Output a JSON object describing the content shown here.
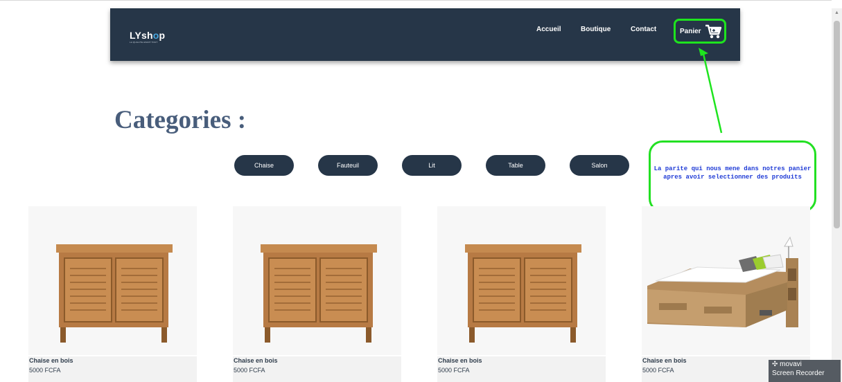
{
  "brand": {
    "name_prefix": "LYsh",
    "name_o": "o",
    "name_suffix": "p",
    "tagline": "LA QUALITE AVANT TOUT"
  },
  "nav": {
    "links": [
      "Accueil",
      "Boutique",
      "Contact"
    ],
    "cart_label": "Panier"
  },
  "page": {
    "heading": "Categories :"
  },
  "categories": [
    "Chaise",
    "Fauteuil",
    "Lit",
    "Table",
    "Salon"
  ],
  "annotation": {
    "text": "La parite qui nous mene dans notres panier apres avoir selectionner des produits"
  },
  "products": [
    {
      "name": "Chaise en bois",
      "price": "5000 FCFA",
      "image": "wooden-cabinet"
    },
    {
      "name": "Chaise en bois",
      "price": "5000 FCFA",
      "image": "wooden-cabinet"
    },
    {
      "name": "Chaise en bois",
      "price": "5000 FCFA",
      "image": "wooden-cabinet"
    },
    {
      "name": "Chaise en bois",
      "price": "5000 FCFA",
      "image": "wooden-bed"
    }
  ],
  "watermark": {
    "brand": "movavi",
    "product": "Screen Recorder"
  },
  "colors": {
    "navbar": "#263648",
    "heading": "#485d7b",
    "highlight": "#1ee41e",
    "annotation_text": "#1f3bd6"
  }
}
